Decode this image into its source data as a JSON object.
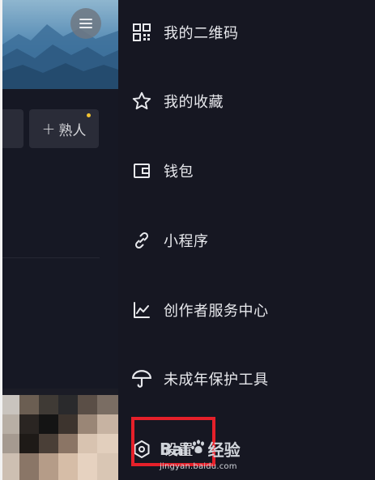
{
  "left_panel": {
    "friend_button": {
      "plus": "+",
      "label": "熟人"
    }
  },
  "drawer": {
    "items": [
      {
        "label": "我的二维码",
        "icon": "qr-code-icon"
      },
      {
        "label": "我的收藏",
        "icon": "star-icon"
      },
      {
        "label": "钱包",
        "icon": "wallet-icon"
      },
      {
        "label": "小程序",
        "icon": "link-icon"
      },
      {
        "label": "创作者服务中心",
        "icon": "chart-icon"
      },
      {
        "label": "未成年保护工具",
        "icon": "umbrella-icon"
      },
      {
        "label": "设置",
        "icon": "settings-hexagon-icon"
      }
    ]
  },
  "watermark": {
    "brand_left": "Bai",
    "brand_right": "经验",
    "url": "jingyan.baidu.com"
  },
  "colors": {
    "drawer_bg": "#161722",
    "text": "#e8e9ed",
    "highlight": "#e5202a",
    "badge": "#f2c231"
  }
}
